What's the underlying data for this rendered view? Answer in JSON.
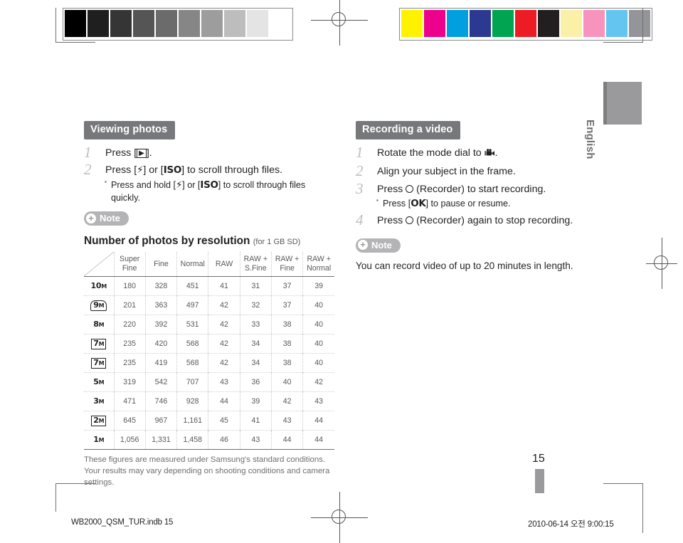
{
  "print_marks": {
    "gray_strip": {
      "name": "grayscale-calibration-strip",
      "swatches": [
        "#000000",
        "#1f1f1f",
        "#353535",
        "#555555",
        "#6b6b6b",
        "#868686",
        "#9d9d9d",
        "#bdbdbd",
        "#e4e4e4",
        "#ffffff"
      ]
    },
    "color_strip": {
      "name": "color-calibration-strip",
      "swatches": [
        "#fff200",
        "#ec008c",
        "#00a0e0",
        "#2b3990",
        "#00a451",
        "#ed1c24",
        "#231f20",
        "#fbf0a8",
        "#f893bd",
        "#64c6f0",
        "#939598"
      ]
    }
  },
  "language_tab": {
    "label": "English",
    "color": "#9a9a9c"
  },
  "left_column": {
    "heading": "Viewing photos",
    "steps": [
      {
        "num": "1",
        "text_before": "Press [",
        "key": "play-button",
        "text_after": "].",
        "sub": []
      },
      {
        "num": "2",
        "text_before": "Press [",
        "key1": "flash-button",
        "text_mid": "] or [",
        "key2": "ISO",
        "text_after": "] to scroll through files.",
        "sub": [
          {
            "before": "Press and hold [",
            "key1": "flash-button",
            "mid": "] or [",
            "key2": "ISO",
            "after": "] to scroll through files quickly."
          }
        ]
      }
    ],
    "note_label": "Note",
    "table_title": "Number of photos by resolution",
    "table_title_sub": "(for 1 GB SD)",
    "table": {
      "headers": [
        "",
        "Super\nFine",
        "Fine",
        "Normal",
        "RAW",
        "RAW +\nS.Fine",
        "RAW +\nFine",
        "RAW +\nNormal"
      ],
      "header_lines": [
        [
          "",
          ""
        ],
        [
          "Super",
          "Fine"
        ],
        [
          "Fine",
          ""
        ],
        [
          "Normal",
          ""
        ],
        [
          "RAW",
          ""
        ],
        [
          "RAW +",
          "S.Fine"
        ],
        [
          "RAW +",
          "Fine"
        ],
        [
          "RAW +",
          "Normal"
        ]
      ],
      "rows": [
        {
          "icon": "10",
          "icon_style": "plain",
          "values": [
            "180",
            "328",
            "451",
            "41",
            "31",
            "37",
            "39"
          ]
        },
        {
          "icon": "9",
          "icon_style": "wide",
          "values": [
            "201",
            "363",
            "497",
            "42",
            "32",
            "37",
            "40"
          ]
        },
        {
          "icon": "8",
          "icon_style": "plain",
          "values": [
            "220",
            "392",
            "531",
            "42",
            "33",
            "38",
            "40"
          ]
        },
        {
          "icon": "7",
          "icon_style": "boxed",
          "values": [
            "235",
            "420",
            "568",
            "42",
            "34",
            "38",
            "40"
          ]
        },
        {
          "icon": "7",
          "icon_style": "boxed",
          "values": [
            "235",
            "419",
            "568",
            "42",
            "34",
            "38",
            "40"
          ]
        },
        {
          "icon": "5",
          "icon_style": "plain",
          "values": [
            "319",
            "542",
            "707",
            "43",
            "36",
            "40",
            "42"
          ]
        },
        {
          "icon": "3",
          "icon_style": "plain",
          "values": [
            "471",
            "746",
            "928",
            "44",
            "39",
            "42",
            "43"
          ]
        },
        {
          "icon": "2",
          "icon_style": "boxed",
          "values": [
            "645",
            "967",
            "1,161",
            "45",
            "41",
            "43",
            "44"
          ]
        },
        {
          "icon": "1",
          "icon_style": "plain",
          "values": [
            "1,056",
            "1,331",
            "1,458",
            "46",
            "43",
            "44",
            "44"
          ]
        }
      ],
      "icon_suffix": "M"
    },
    "table_footnote": "These figures are measured under Samsung's standard conditions. Your results may vary depending on shooting conditions and camera settings."
  },
  "right_column": {
    "heading": "Recording a video",
    "steps": [
      {
        "num": "1",
        "before": "Rotate the mode dial to ",
        "glyph": "movie-mode-icon",
        "after": ".",
        "sub": []
      },
      {
        "num": "2",
        "before": "Align your subject in the frame.",
        "after": "",
        "sub": []
      },
      {
        "num": "3",
        "before": "Press ",
        "glyph": "recorder-button-icon",
        "after": " (Recorder) to start recording.",
        "sub": [
          {
            "before": "Press [",
            "key": "OK",
            "after": "] to pause or resume."
          }
        ]
      },
      {
        "num": "4",
        "before": "Press ",
        "glyph": "recorder-button-icon",
        "after": " (Recorder) again to stop recording.",
        "sub": []
      }
    ],
    "note_label": "Note",
    "note_body": "You can record video of up to 20 minutes in length."
  },
  "page_number": "15",
  "footer": {
    "file": "WB2000_QSM_TUR.indb   15",
    "timestamp": "2010-06-14   오전 9:00:15"
  }
}
